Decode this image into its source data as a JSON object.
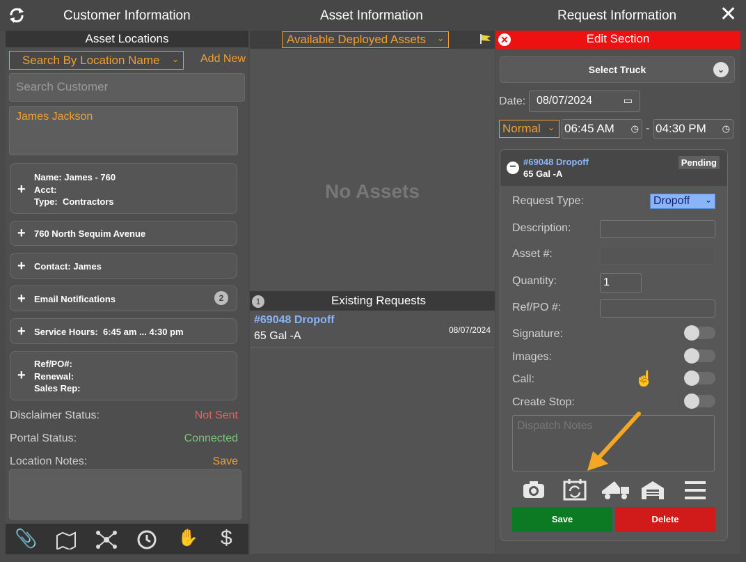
{
  "header": {
    "tab_customer": "Customer Information",
    "tab_asset": "Asset Information",
    "tab_request": "Request Information"
  },
  "left": {
    "title": "Asset Locations",
    "search_mode": "Search By Location Name",
    "add_new": "Add New",
    "search_placeholder": "Search Customer",
    "selected_customer": "James Jackson",
    "info": {
      "name_label": "Name:",
      "name_value": "James - 760",
      "acct_label": "Acct:",
      "acct_value": "",
      "type_label": "Type:",
      "type_value": "Contractors"
    },
    "address": "760 North Sequim Avenue",
    "contact_label": "Contact:",
    "contact_value": "James",
    "email_label": "Email Notifications",
    "email_count": "2",
    "service_label": "Service Hours:",
    "service_value": "6:45 am ... 4:30 pm",
    "ref_label": "Ref/PO#:",
    "renewal_label": "Renewal:",
    "salesrep_label": "Sales Rep:",
    "disclaimer_label": "Disclaimer Status:",
    "disclaimer_value": "Not Sent",
    "portal_label": "Portal Status:",
    "portal_value": "Connected",
    "notes_label": "Location Notes:",
    "notes_save": "Save",
    "colors": {
      "accent": "#f0a030",
      "not_sent": "#e86060",
      "connected": "#7fc47f"
    }
  },
  "middle": {
    "filter": "Available Deployed Assets",
    "empty": "No Assets",
    "existing_title": "Existing Requests",
    "existing_count": "1",
    "requests": [
      {
        "id_label": "#69048 Dropoff",
        "item": "65 Gal -A",
        "date": "08/07/2024"
      }
    ]
  },
  "right": {
    "title": "Edit Section",
    "truck": "Select Truck",
    "date_label": "Date:",
    "date_value": "08/07/2024",
    "priority": "Normal",
    "time_start": "06:45 AM",
    "time_sep": "-",
    "time_end": "04:30 PM",
    "card": {
      "id_label": "#69048 Dropoff",
      "item": "65 Gal -A",
      "status": "Pending",
      "request_type_label": "Request Type:",
      "request_type_value": "Dropoff",
      "description_label": "Description:",
      "asset_label": "Asset #:",
      "quantity_label": "Quantity:",
      "quantity_value": "1",
      "ref_label": "Ref/PO #:",
      "signature_label": "Signature:",
      "images_label": "Images:",
      "call_label": "Call:",
      "create_stop_label": "Create Stop:",
      "notes_placeholder": "Dispatch Notes",
      "save": "Save",
      "delete": "Delete"
    }
  }
}
